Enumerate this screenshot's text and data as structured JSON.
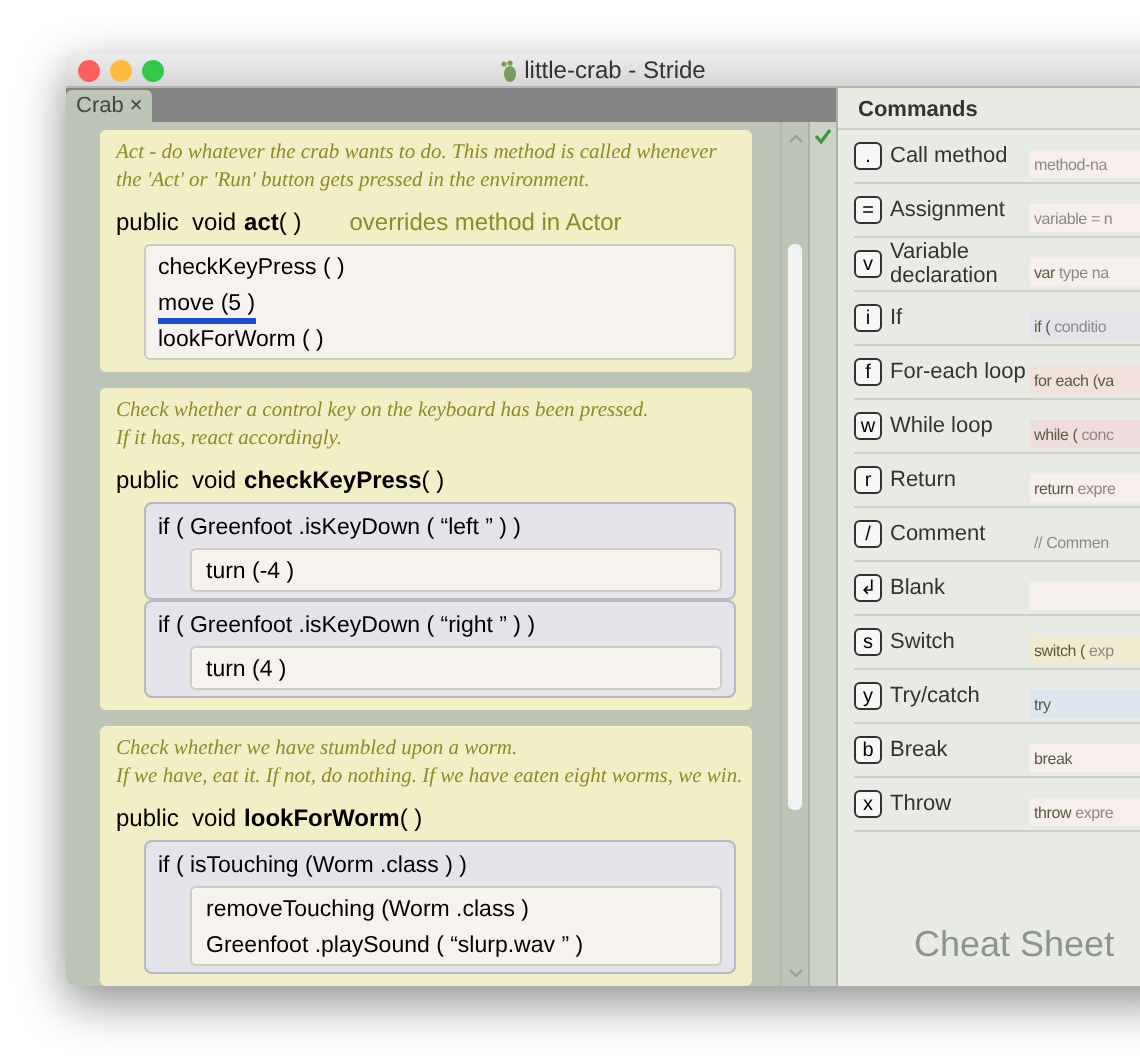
{
  "window": {
    "title": "little-crab - Stride"
  },
  "tabs": [
    {
      "label": "Crab ×",
      "selected": true
    }
  ],
  "methods": [
    {
      "comment": [
        "Act - do whatever the crab wants to do. This method is called whenever",
        "the 'Act' or 'Run' button gets pressed in the environment."
      ],
      "modifiers": "public  void",
      "name": "act",
      "params": "( )",
      "override_note": "overrides method in Actor",
      "body": [
        {
          "kind": "call",
          "code": "checkKeyPress ( )",
          "cursor": false
        },
        {
          "kind": "call",
          "code": "move (5 )",
          "cursor": true
        },
        {
          "kind": "call",
          "code": "lookForWorm ( )",
          "cursor": false
        }
      ]
    },
    {
      "comment": [
        "Check whether a control key on the keyboard has been pressed.",
        "If it has, react accordingly."
      ],
      "modifiers": "public  void",
      "name": "checkKeyPress",
      "params": "( )",
      "body": [
        {
          "kind": "if",
          "code": "if ( Greenfoot .isKeyDown ( “left ” ) )",
          "cursor": false,
          "children": [
            {
              "kind": "call",
              "code": "turn (-4 )",
              "cursor": false
            }
          ]
        },
        {
          "kind": "if",
          "code": "if ( Greenfoot .isKeyDown ( “right ” ) )",
          "cursor": false,
          "children": [
            {
              "kind": "call",
              "code": "turn (4 )",
              "cursor": false
            }
          ]
        }
      ]
    },
    {
      "comment": [
        "Check whether we have stumbled upon a worm.",
        "If we have, eat it. If not, do nothing. If we have eaten eight worms, we win."
      ],
      "modifiers": "public  void",
      "name": "lookForWorm",
      "params": "( )",
      "body": [
        {
          "kind": "if",
          "code": "if ( isTouching (Worm .class ) )",
          "cursor": false,
          "children": [
            {
              "kind": "call",
              "code": "removeTouching (Worm .class )",
              "cursor": false
            },
            {
              "kind": "call",
              "code": "Greenfoot .playSound ( “slurp.wav ” )",
              "cursor": false
            }
          ]
        }
      ]
    }
  ],
  "commands": {
    "title": "Commands",
    "footer": "Cheat Sheet",
    "items": [
      {
        "key": ".",
        "label": "Call method",
        "hint": "method-na",
        "color": "#f6efec"
      },
      {
        "key": "=",
        "label": "Assignment",
        "hint": "variable = n",
        "color": "#f6efec"
      },
      {
        "key": "v",
        "label": "Variable declaration",
        "keyword": "var",
        "hint": "type na",
        "color": "#f6efec"
      },
      {
        "key": "i",
        "label": "If",
        "keyword": "if (",
        "hint": "conditio",
        "color": "#e4e4ea"
      },
      {
        "key": "f",
        "label": "For-each loop",
        "keyword": "for each (va",
        "color": "#f2e0db"
      },
      {
        "key": "w",
        "label": "While loop",
        "keyword": "while (",
        "hint": "conc",
        "color": "#efdcdc"
      },
      {
        "key": "r",
        "label": "Return",
        "keyword": "return",
        "hint": "expre",
        "color": "#f6efec"
      },
      {
        "key": "/",
        "label": "Comment",
        "hint": "// Commen",
        "color": "#e8ebe4"
      },
      {
        "key": "↲",
        "label": "Blank",
        "color": "#f6f0ee"
      },
      {
        "key": "s",
        "label": "Switch",
        "keyword": "switch (",
        "hint": "exp",
        "color": "#f2ebcf"
      },
      {
        "key": "y",
        "label": "Try/catch",
        "keyword": "try",
        "color": "#dbe6ee"
      },
      {
        "key": "b",
        "label": "Break",
        "keyword": "break",
        "color": "#f6efec"
      },
      {
        "key": "x",
        "label": "Throw",
        "keyword": "throw",
        "hint": "expre",
        "color": "#f6efec"
      }
    ]
  }
}
